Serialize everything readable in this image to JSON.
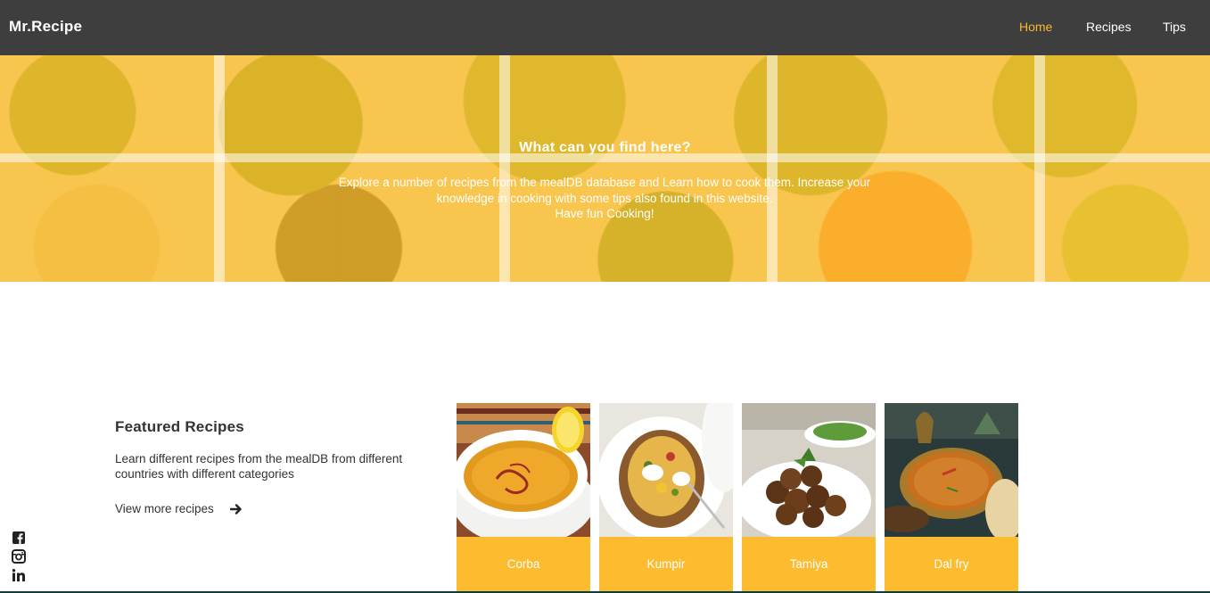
{
  "navbar": {
    "brand": "Mr.Recipe",
    "links": [
      {
        "label": "Home",
        "active": true
      },
      {
        "label": "Recipes",
        "active": false
      },
      {
        "label": "Tips",
        "active": false
      }
    ]
  },
  "hero": {
    "title": "What can you find here?",
    "line1": "Explore a number of recipes from the mealDB database and Learn how to cook them. Increase your knowledge in cooking with some tips also found in this website.",
    "line2": "Have fun Cooking!"
  },
  "featured": {
    "title": "Featured Recipes",
    "description": "Learn different recipes from the mealDB from different countries with different categories",
    "view_more": "View more recipes",
    "arrow_icon": "arrow-right-icon"
  },
  "recipes": [
    {
      "name": "Corba"
    },
    {
      "name": "Kumpir"
    },
    {
      "name": "Tamiya"
    },
    {
      "name": "Dal fry"
    }
  ],
  "social": {
    "icons": [
      "facebook-icon",
      "instagram-icon",
      "linkedin-icon"
    ]
  },
  "colors": {
    "navbar_bg": "#3e3e3e",
    "accent": "#fdbb2f",
    "active_link": "#f7b733",
    "text_dark": "#333333"
  }
}
